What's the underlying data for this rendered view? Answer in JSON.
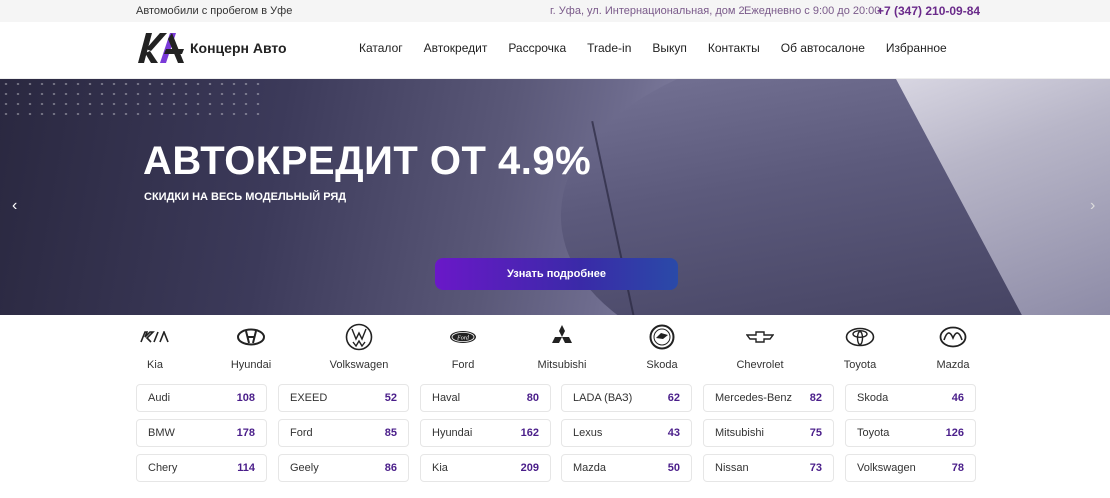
{
  "topbar": {
    "tagline": "Автомобили с пробегом в Уфе",
    "address": "г. Уфа, ул. Интернациональная, дом 2",
    "hours": "Ежедневно с 9:00 до 20:00",
    "phone": "+7 (347) 210-09-84"
  },
  "header": {
    "brand": "Концерн Авто",
    "nav": [
      "Каталог",
      "Автокредит",
      "Рассрочка",
      "Trade-in",
      "Выкуп",
      "Контакты",
      "Об автосалоне",
      "Избранное"
    ]
  },
  "hero": {
    "title": "АВТОКРЕДИТ ОТ 4.9%",
    "subtitle": "СКИДКИ НА ВЕСЬ МОДЕЛЬНЫЙ РЯД",
    "cta": "Узнать подробнее",
    "prev": "‹",
    "next": "›"
  },
  "brand_logos": [
    {
      "label": "Kia",
      "icon": "kia-logo-icon"
    },
    {
      "label": "Hyundai",
      "icon": "hyundai-logo-icon"
    },
    {
      "label": "Volkswagen",
      "icon": "volkswagen-logo-icon"
    },
    {
      "label": "Ford",
      "icon": "ford-logo-icon"
    },
    {
      "label": "Mitsubishi",
      "icon": "mitsubishi-logo-icon"
    },
    {
      "label": "Skoda",
      "icon": "skoda-logo-icon"
    },
    {
      "label": "Chevrolet",
      "icon": "chevrolet-logo-icon"
    },
    {
      "label": "Toyota",
      "icon": "toyota-logo-icon"
    },
    {
      "label": "Mazda",
      "icon": "mazda-logo-icon"
    }
  ],
  "brand_counts": [
    [
      {
        "name": "Audi",
        "count": "108"
      },
      {
        "name": "EXEED",
        "count": "52"
      },
      {
        "name": "Haval",
        "count": "80"
      },
      {
        "name": "LADA (ВАЗ)",
        "count": "62"
      },
      {
        "name": "Mercedes-Benz",
        "count": "82"
      },
      {
        "name": "Skoda",
        "count": "46"
      }
    ],
    [
      {
        "name": "BMW",
        "count": "178"
      },
      {
        "name": "Ford",
        "count": "85"
      },
      {
        "name": "Hyundai",
        "count": "162"
      },
      {
        "name": "Lexus",
        "count": "43"
      },
      {
        "name": "Mitsubishi",
        "count": "75"
      },
      {
        "name": "Toyota",
        "count": "126"
      }
    ],
    [
      {
        "name": "Chery",
        "count": "114"
      },
      {
        "name": "Geely",
        "count": "86"
      },
      {
        "name": "Kia",
        "count": "209"
      },
      {
        "name": "Mazda",
        "count": "50"
      },
      {
        "name": "Nissan",
        "count": "73"
      },
      {
        "name": "Volkswagen",
        "count": "78"
      }
    ]
  ],
  "colors": {
    "accent": "#4a1e8a",
    "phone": "#6a2a8a",
    "cta_start": "#6a18c8",
    "cta_end": "#2a4aa8"
  }
}
